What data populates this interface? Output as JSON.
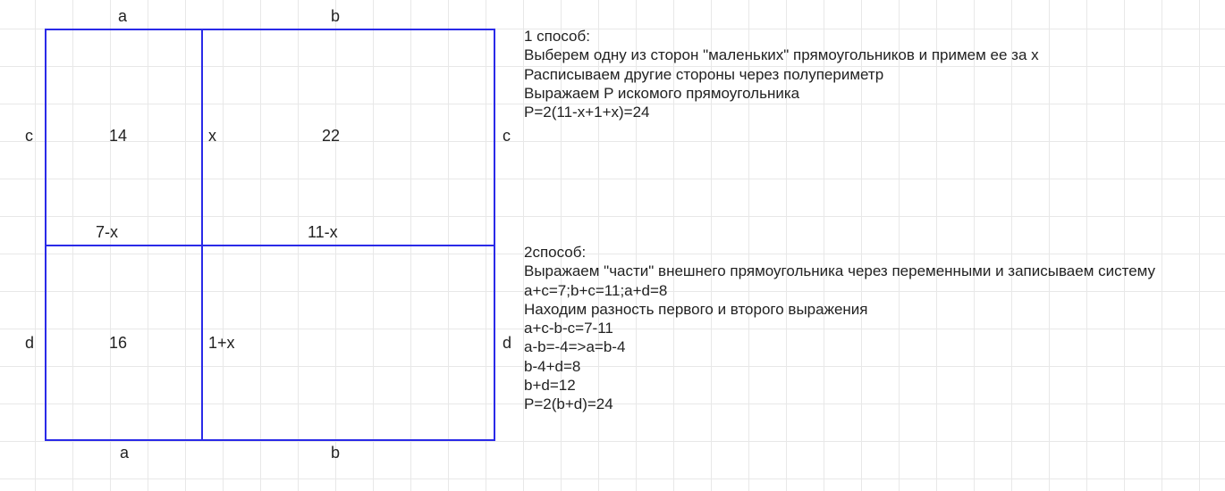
{
  "diagram": {
    "top": {
      "a": "a",
      "b": "b"
    },
    "bottom": {
      "a": "a",
      "b": "b"
    },
    "left": {
      "c": "c",
      "d": "d"
    },
    "right": {
      "c": "c",
      "d": "d"
    },
    "inner": {
      "cell_tl_area": "14",
      "cell_tr_area": "22",
      "cell_bl_area": "16",
      "x": "x",
      "bottom_left_expr": "7-x",
      "bottom_right_expr": "11-x",
      "d_inner": "1+x"
    }
  },
  "method1": {
    "title": "1 способ:",
    "line1": "Выберем одну из сторон \"маленьких\" прямоугольников и примем ее за x",
    "line2": "Расписываем другие стороны через полупериметр",
    "line3": "Выражаем P искомого прямоугольника",
    "line4": "P=2(11-x+1+x)=24"
  },
  "method2": {
    "title": "2способ:",
    "line1": "Выражаем \"части\" внешнего прямоугольника через переменными и записываем систему",
    "line2": "a+c=7;b+c=11;a+d=8",
    "line3": "Находим разность первого и второго выражения",
    "line4": "a+c-b-c=7-11",
    "line5": " a-b=-4=>a=b-4",
    "line6": "b-4+d=8",
    "line7": "b+d=12",
    "line8": "P=2(b+d)=24"
  }
}
